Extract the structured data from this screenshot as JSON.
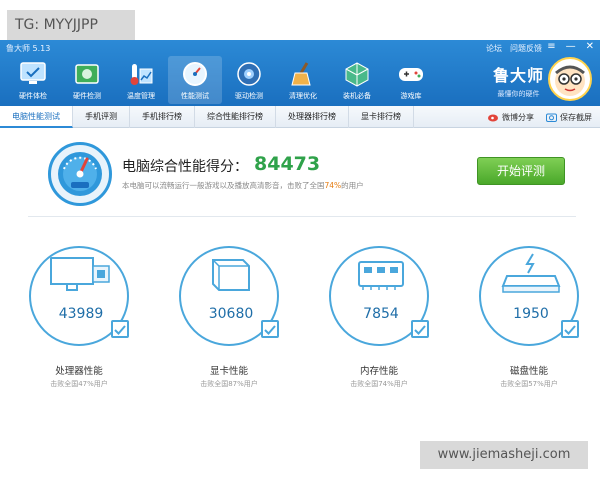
{
  "watermarks": {
    "top": "TG: MYYJJPP",
    "bottom": "www.jiemasheji.com"
  },
  "window": {
    "title": "鲁大师 5.13",
    "links": [
      "论坛",
      "问题反馈"
    ]
  },
  "nav": [
    {
      "label": "硬件体检",
      "icon": "monitor-check-icon"
    },
    {
      "label": "硬件检测",
      "icon": "chip-icon"
    },
    {
      "label": "温度管理",
      "icon": "thermometer-icon"
    },
    {
      "label": "性能测试",
      "icon": "speed-gauge-icon",
      "active": true
    },
    {
      "label": "驱动检测",
      "icon": "gear-disc-icon"
    },
    {
      "label": "清理优化",
      "icon": "broom-icon"
    },
    {
      "label": "装机必备",
      "icon": "cube-icon"
    },
    {
      "label": "游戏库",
      "icon": "gamepad-icon"
    }
  ],
  "brand": {
    "name": "鲁大师",
    "slogan": "最懂你的硬件"
  },
  "tabs": [
    "电脑性能测试",
    "手机评测",
    "手机排行榜",
    "综合性能排行榜",
    "处理器排行榜",
    "显卡排行榜"
  ],
  "tab_actions": {
    "share": "微博分享",
    "save": "保存截屏"
  },
  "score": {
    "title": "电脑综合性能得分：",
    "value": "84473",
    "gauge_label": "",
    "desc_prefix": "本电脑可以流畅运行一般游戏以及播放高清影音，击败了全国",
    "desc_pct": "74%",
    "desc_suffix": "的用户",
    "button": "开始评测"
  },
  "cards": [
    {
      "name": "处理器性能",
      "value": "43989",
      "sub": "击败全国47%用户",
      "icon": "cpu-monitor-icon"
    },
    {
      "name": "显卡性能",
      "value": "30680",
      "sub": "击败全国87%用户",
      "icon": "graphics-cube-icon"
    },
    {
      "name": "内存性能",
      "value": "7854",
      "sub": "击败全国74%用户",
      "icon": "memory-chip-icon"
    },
    {
      "name": "磁盘性能",
      "value": "1950",
      "sub": "击败全国57%用户",
      "icon": "disk-drive-icon"
    }
  ],
  "colors": {
    "header": "#1a6fbf",
    "accent": "#2c8ad6",
    "score": "#2fa24a",
    "highlight": "#e57b0f",
    "button": "#4aa82a"
  }
}
